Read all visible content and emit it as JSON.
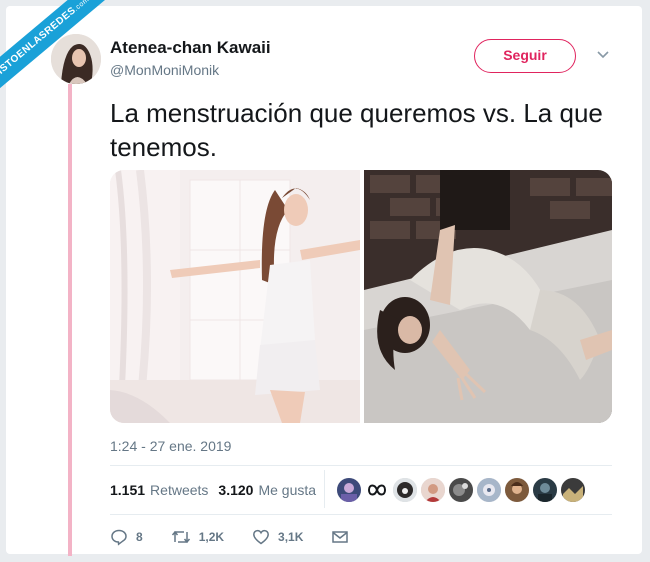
{
  "watermark": {
    "text": "VISTOENLASREDES",
    "suffix": ".com"
  },
  "author": {
    "name": "Atenea-chan Kawaii",
    "handle": "@MonMoniMonik"
  },
  "follow_label": "Seguir",
  "tweet": {
    "text": "La menstruación que queremos vs. La que tenemos.",
    "timestamp": "1:24 - 27 ene. 2019"
  },
  "stats": {
    "retweets": {
      "value": "1.151",
      "label": "Retweets"
    },
    "likes": {
      "value": "3.120",
      "label": "Me gusta"
    }
  },
  "liker_avatars_count": 10,
  "actions": {
    "reply": "8",
    "retweet": "1,2K",
    "like": "3,1K"
  },
  "colors": {
    "accent": "#e0245e",
    "thread_line": "#f3b3c6",
    "muted": "#657786",
    "ribbon": "#1aa1d8"
  }
}
